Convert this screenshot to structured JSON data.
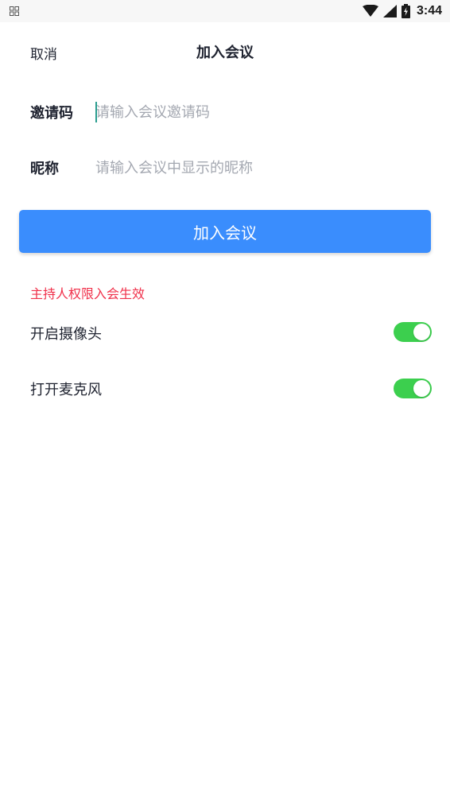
{
  "status_bar": {
    "time": "3:44",
    "icons": [
      "grid-icon",
      "wifi-icon",
      "signal-icon",
      "battery-icon"
    ]
  },
  "header": {
    "cancel_label": "取消",
    "title": "加入会议"
  },
  "form": {
    "invite_code": {
      "label": "邀请码",
      "placeholder": "请输入会议邀请码",
      "value": ""
    },
    "nickname": {
      "label": "昵称",
      "placeholder": "请输入会议中显示的昵称",
      "value": ""
    }
  },
  "join_button": {
    "label": "加入会议"
  },
  "host_notice": "主持人权限入会生效",
  "toggles": [
    {
      "label": "开启摄像头",
      "on": true
    },
    {
      "label": "打开麦克风",
      "on": true
    }
  ],
  "colors": {
    "primary": "#3a8dfd",
    "toggle_on": "#3ccf4e",
    "notice": "#f0304a",
    "caret": "#2a9d8f",
    "placeholder": "#a4a8b1"
  }
}
